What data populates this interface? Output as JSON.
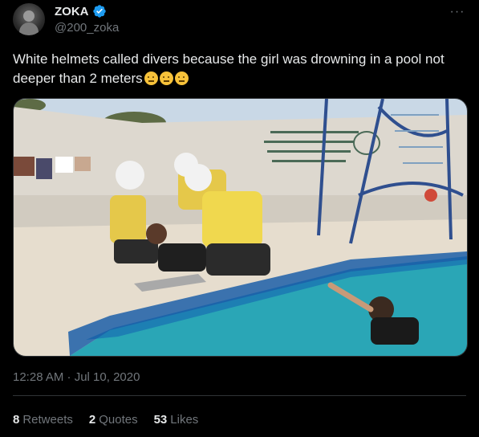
{
  "author": {
    "display_name": "ZOKA",
    "handle": "@200_zoka",
    "verified_icon": "verified-badge-icon",
    "verified_color": "#1d9bf0"
  },
  "tweet": {
    "text": "White helmets called divers because the girl was drowning in a pool not deeper than 2 meters",
    "emojis": [
      "thinking-face-emoji",
      "face-with-raised-eyebrow-emoji",
      "face-with-raised-eyebrow-emoji"
    ],
    "media_description_icon": "video-thumbnail",
    "timestamp": "12:28 AM · Jul 10, 2020"
  },
  "stats": {
    "retweets_count": "8",
    "retweets_label": "Retweets",
    "quotes_count": "2",
    "quotes_label": "Quotes",
    "likes_count": "53",
    "likes_label": "Likes"
  },
  "colors": {
    "background": "#000000",
    "text_primary": "#e7e9ea",
    "text_secondary": "#71767b",
    "border": "#2f3336"
  }
}
